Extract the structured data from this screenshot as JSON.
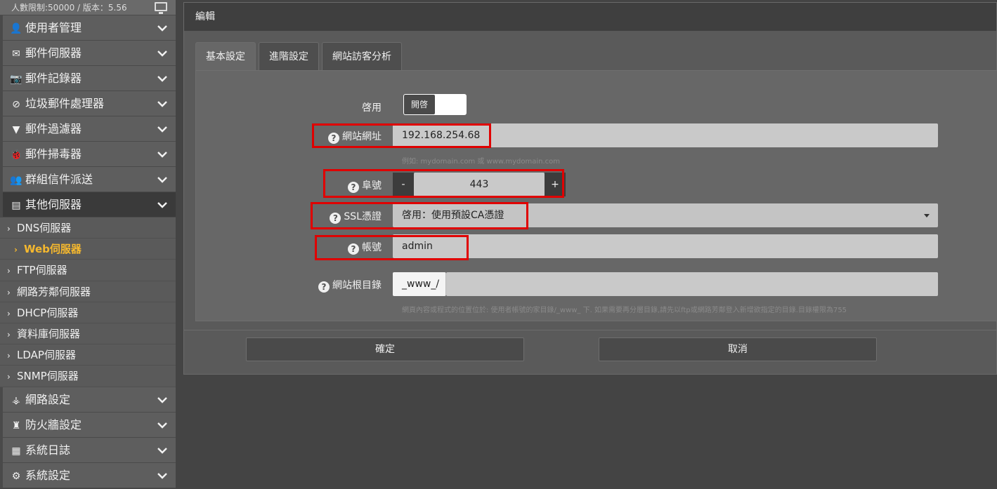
{
  "sidebar": {
    "top_text": "人數限制:50000 / 版本：5.56",
    "menu_before": [
      {
        "label": "使用者管理",
        "icon": "user-icon",
        "glyph": "👤"
      },
      {
        "label": "郵件伺服器",
        "icon": "envelope-icon",
        "glyph": "✉"
      },
      {
        "label": "郵件記錄器",
        "icon": "camera-icon",
        "glyph": "📷"
      },
      {
        "label": "垃圾郵件處理器",
        "icon": "ban-icon",
        "glyph": "⊘"
      },
      {
        "label": "郵件過濾器",
        "icon": "filter-icon",
        "glyph": "▼"
      },
      {
        "label": "郵件掃毒器",
        "icon": "bug-icon",
        "glyph": "🐞"
      },
      {
        "label": "群組信件派送",
        "icon": "users-icon",
        "glyph": "👥"
      }
    ],
    "active_menu": {
      "label": "其他伺服器",
      "icon": "server-icon",
      "glyph": "▤"
    },
    "sub_items": [
      "DNS伺服器",
      "Web伺服器",
      "FTP伺服器",
      "網路芳鄰伺服器",
      "DHCP伺服器",
      "資料庫伺服器",
      "LDAP伺服器",
      "SNMP伺服器"
    ],
    "active_sub": "Web伺服器",
    "menu_after": [
      {
        "label": "網路設定",
        "icon": "sitemap-icon",
        "glyph": "⚶"
      },
      {
        "label": "防火牆設定",
        "icon": "castle-icon",
        "glyph": "♜"
      },
      {
        "label": "系統日誌",
        "icon": "film-icon",
        "glyph": "▦"
      },
      {
        "label": "系統設定",
        "icon": "cogs-icon",
        "glyph": "⚙"
      }
    ]
  },
  "dialog": {
    "title": "編輯",
    "tabs": [
      "基本設定",
      "進階設定",
      "網站訪客分析"
    ],
    "active_tab": "基本設定",
    "form": {
      "enable_label": "啓用",
      "toggle_text": "開啓",
      "toggle_state": "on",
      "site_url_label": "網站網址",
      "site_url_value": "192.168.254.68",
      "site_url_hint": "例如: mydomain.com 或 www.mydomain.com",
      "port_label": "阜號",
      "port_value": "443",
      "port_minus": "-",
      "port_plus": "+",
      "ssl_label": "SSL憑證",
      "ssl_value": "啓用：使用預設CA憑證",
      "account_label": "帳號",
      "account_value": "admin",
      "root_label": "網站根目錄",
      "root_prefix": "_www_/",
      "root_value": "",
      "root_hint": "網頁內容或程式的位置位於: 使用者帳號的家目錄/_www_ 下. 如果需要再分層目錄,請先以ftp或網路芳鄰登入新增欲指定的目錄.目錄權限為755"
    },
    "confirm_label": "確定",
    "cancel_label": "取消"
  },
  "colors": {
    "highlight_border": "#e00000",
    "active_sub_text": "#f5b82e"
  }
}
